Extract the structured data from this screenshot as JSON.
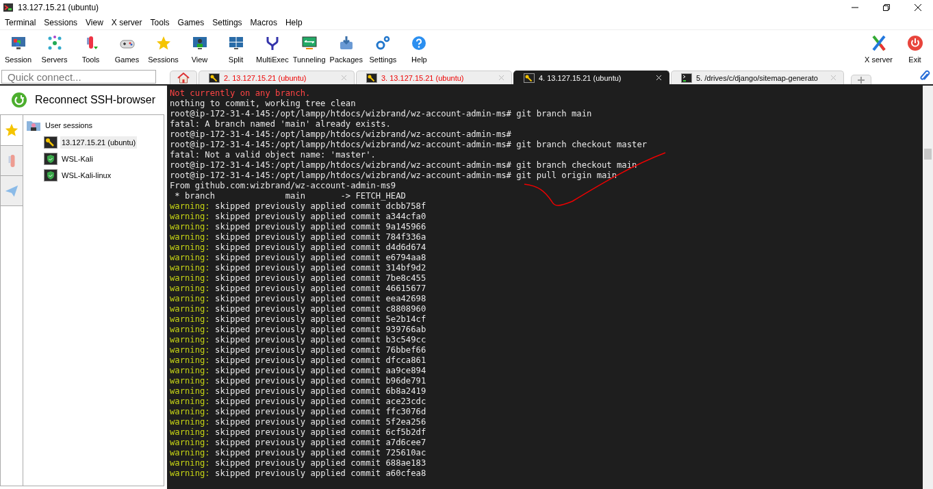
{
  "window": {
    "title": "13.127.15.21 (ubuntu)"
  },
  "menu": [
    "Terminal",
    "Sessions",
    "View",
    "X server",
    "Tools",
    "Games",
    "Settings",
    "Macros",
    "Help"
  ],
  "toolbar": [
    {
      "label": "Session",
      "kind": "session"
    },
    {
      "label": "Servers",
      "kind": "servers"
    },
    {
      "label": "Tools",
      "kind": "tools"
    },
    {
      "label": "Games",
      "kind": "games"
    },
    {
      "label": "Sessions",
      "kind": "star"
    },
    {
      "label": "View",
      "kind": "view"
    },
    {
      "label": "Split",
      "kind": "split"
    },
    {
      "label": "MultiExec",
      "kind": "fork"
    },
    {
      "label": "Tunneling",
      "kind": "tunnel"
    },
    {
      "label": "Packages",
      "kind": "packages"
    },
    {
      "label": "Settings",
      "kind": "gears"
    },
    {
      "label": "Help",
      "kind": "help"
    }
  ],
  "toolbar_right": [
    {
      "label": "X server",
      "kind": "x"
    },
    {
      "label": "Exit",
      "kind": "power"
    }
  ],
  "quick_connect": {
    "placeholder": "Quick connect..."
  },
  "tabs": [
    {
      "kind": "home",
      "selected": false
    },
    {
      "kind": "ssh",
      "label": "2. 13.127.15.21 (ubuntu)",
      "disconnected": true,
      "selected": false
    },
    {
      "kind": "ssh",
      "label": "3. 13.127.15.21 (ubuntu)",
      "disconnected": true,
      "selected": false
    },
    {
      "kind": "ssh",
      "label": "4. 13.127.15.21 (ubuntu)",
      "disconnected": false,
      "selected": true
    },
    {
      "kind": "terminal",
      "label": "5. /drives/c/django/sitemap-generato",
      "disconnected": false,
      "selected": false
    }
  ],
  "sidebar": {
    "reconnect": "Reconnect SSH-browser",
    "side_tabs": [
      {
        "kind": "star",
        "selected": true
      },
      {
        "kind": "tools",
        "selected": false
      },
      {
        "kind": "send",
        "selected": false
      }
    ],
    "tree": {
      "label": "User sessions",
      "children": [
        {
          "label": "13.127.15.21 (ubuntu)",
          "kind": "ssh",
          "selected": true
        },
        {
          "label": "WSL-Kali",
          "kind": "wsl",
          "selected": false
        },
        {
          "label": "WSL-Kali-linux",
          "kind": "wsl",
          "selected": false
        }
      ]
    }
  },
  "terminal": {
    "lines": [
      {
        "kind": "error",
        "text": "Not currently on any branch."
      },
      {
        "kind": "plain",
        "text": "nothing to commit, working tree clean"
      },
      {
        "kind": "plain",
        "text": "root@ip-172-31-4-145:/opt/lampp/htdocs/wizbrand/wz-account-admin-ms# git branch main"
      },
      {
        "kind": "plain",
        "text": "fatal: A branch named 'main' already exists."
      },
      {
        "kind": "plain",
        "text": "root@ip-172-31-4-145:/opt/lampp/htdocs/wizbrand/wz-account-admin-ms#"
      },
      {
        "kind": "plain",
        "text": "root@ip-172-31-4-145:/opt/lampp/htdocs/wizbrand/wz-account-admin-ms# git branch checkout master"
      },
      {
        "kind": "plain",
        "text": "fatal: Not a valid object name: 'master'."
      },
      {
        "kind": "plain",
        "text": "root@ip-172-31-4-145:/opt/lampp/htdocs/wizbrand/wz-account-admin-ms# git branch checkout main"
      },
      {
        "kind": "plain",
        "text": "root@ip-172-31-4-145:/opt/lampp/htdocs/wizbrand/wz-account-admin-ms# git pull origin main"
      },
      {
        "kind": "plain",
        "text": "From github.com:wizbrand/wz-account-admin-ms9"
      },
      {
        "kind": "plain",
        "text": " * branch              main       -> FETCH_HEAD"
      },
      {
        "kind": "warning",
        "prefix": "warning:",
        "text": " skipped previously applied commit dcbb758f"
      },
      {
        "kind": "warning",
        "prefix": "warning:",
        "text": " skipped previously applied commit a344cfa0"
      },
      {
        "kind": "warning",
        "prefix": "warning:",
        "text": " skipped previously applied commit 9a145966"
      },
      {
        "kind": "warning",
        "prefix": "warning:",
        "text": " skipped previously applied commit 784f336a"
      },
      {
        "kind": "warning",
        "prefix": "warning:",
        "text": " skipped previously applied commit d4d6d674"
      },
      {
        "kind": "warning",
        "prefix": "warning:",
        "text": " skipped previously applied commit e6794aa8"
      },
      {
        "kind": "warning",
        "prefix": "warning:",
        "text": " skipped previously applied commit 314bf9d2"
      },
      {
        "kind": "warning",
        "prefix": "warning:",
        "text": " skipped previously applied commit 7be8c455"
      },
      {
        "kind": "warning",
        "prefix": "warning:",
        "text": " skipped previously applied commit 46615677"
      },
      {
        "kind": "warning",
        "prefix": "warning:",
        "text": " skipped previously applied commit eea42698"
      },
      {
        "kind": "warning",
        "prefix": "warning:",
        "text": " skipped previously applied commit c8808960"
      },
      {
        "kind": "warning",
        "prefix": "warning:",
        "text": " skipped previously applied commit 5e2b14cf"
      },
      {
        "kind": "warning",
        "prefix": "warning:",
        "text": " skipped previously applied commit 939766ab"
      },
      {
        "kind": "warning",
        "prefix": "warning:",
        "text": " skipped previously applied commit b3c549cc"
      },
      {
        "kind": "warning",
        "prefix": "warning:",
        "text": " skipped previously applied commit 76bbef66"
      },
      {
        "kind": "warning",
        "prefix": "warning:",
        "text": " skipped previously applied commit dfcca861"
      },
      {
        "kind": "warning",
        "prefix": "warning:",
        "text": " skipped previously applied commit aa9ce894"
      },
      {
        "kind": "warning",
        "prefix": "warning:",
        "text": " skipped previously applied commit b96de791"
      },
      {
        "kind": "warning",
        "prefix": "warning:",
        "text": " skipped previously applied commit 6b8a2419"
      },
      {
        "kind": "warning",
        "prefix": "warning:",
        "text": " skipped previously applied commit ace23cdc"
      },
      {
        "kind": "warning",
        "prefix": "warning:",
        "text": " skipped previously applied commit ffc3076d"
      },
      {
        "kind": "warning",
        "prefix": "warning:",
        "text": " skipped previously applied commit 5f2ea256"
      },
      {
        "kind": "warning",
        "prefix": "warning:",
        "text": " skipped previously applied commit 6cf5b2df"
      },
      {
        "kind": "warning",
        "prefix": "warning:",
        "text": " skipped previously applied commit a7d6cee7"
      },
      {
        "kind": "warning",
        "prefix": "warning:",
        "text": " skipped previously applied commit 725610ac"
      },
      {
        "kind": "warning",
        "prefix": "warning:",
        "text": " skipped previously applied commit 688ae183"
      },
      {
        "kind": "warning",
        "prefix": "warning:",
        "text": " skipped previously applied commit a60cfea8"
      }
    ]
  }
}
